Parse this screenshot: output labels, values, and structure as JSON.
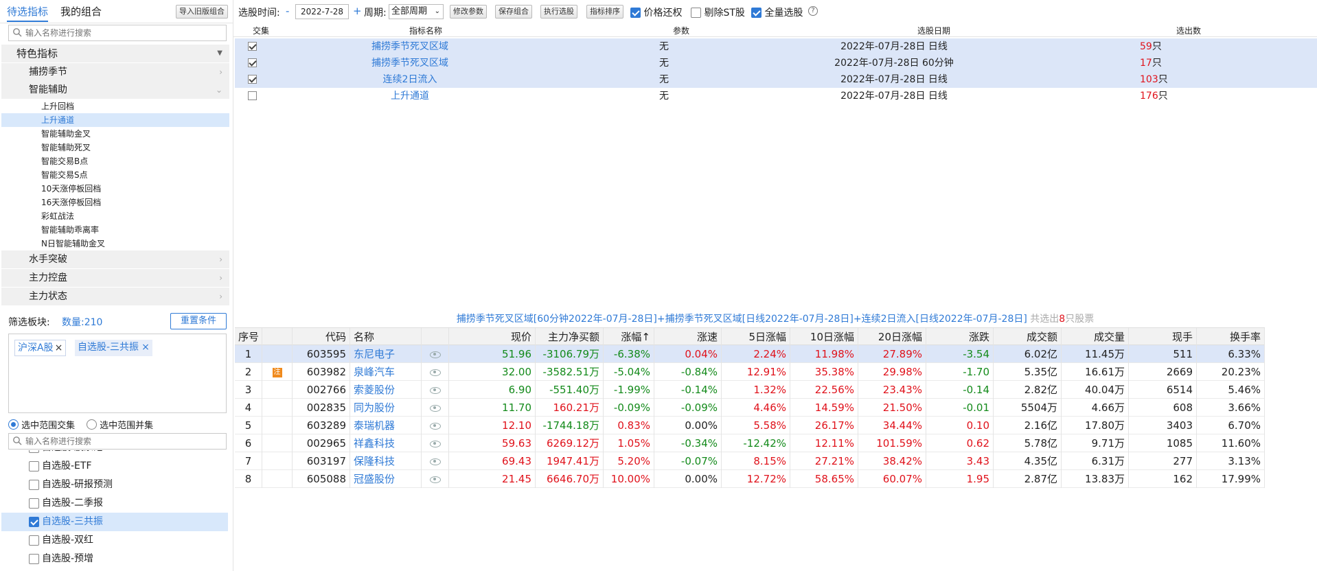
{
  "tabs": {
    "candidate": "待选指标",
    "my_combo": "我的组合",
    "import_old": "导入旧版组合"
  },
  "search": {
    "placeholder": "输入名称进行搜索"
  },
  "tree": {
    "root": "特色指标",
    "categories": [
      {
        "label": "捕捞季节"
      },
      {
        "label": "智能辅助"
      }
    ],
    "sub_items": [
      "上升回档",
      "上升通道",
      "智能辅助金叉",
      "智能辅助死叉",
      "智能交易B点",
      "智能交易S点",
      "10天涨停板回档",
      "16天涨停板回档",
      "彩虹战法",
      "智能辅助乖离率",
      "N日智能辅助金叉"
    ],
    "categories_after": [
      {
        "label": "水手突破"
      },
      {
        "label": "主力控盘"
      },
      {
        "label": "主力状态"
      }
    ]
  },
  "filter": {
    "label": "筛选板块:",
    "count_label": "数量:210",
    "reset": "重置条件",
    "tags": [
      "沪深A股",
      "自选股-三共振"
    ],
    "radio_intersect": "选中范围交集",
    "radio_union": "选中范围并集"
  },
  "stock_lists": [
    "自选股-股票池",
    "自选股-ETF",
    "自选股-研报预测",
    "自选股-二季报",
    "自选股-三共振",
    "自选股-双红",
    "自选股-预增"
  ],
  "toolbar": {
    "time_label": "选股时间:",
    "minus": "-",
    "date": "2022-7-28",
    "plus": "+",
    "period_label": "周期:",
    "period_value": "全部周期",
    "modify": "修改参数",
    "save": "保存组合",
    "execute": "执行选股",
    "sort": "指标排序",
    "price_restore": "价格还权",
    "remove_st": "剔除ST股",
    "full_select": "全量选股",
    "help": "?"
  },
  "indicator_table": {
    "headers": [
      "交集",
      "指标名称",
      "参数",
      "选股日期",
      "选出数"
    ],
    "rows": [
      {
        "checked": true,
        "name": "捕捞季节死叉区域",
        "param": "无",
        "date": "2022年-07月-28日 日线",
        "count": "59",
        "unit": "只"
      },
      {
        "checked": true,
        "name": "捕捞季节死叉区域",
        "param": "无",
        "date": "2022年-07月-28日 60分钟",
        "count": "17",
        "unit": "只"
      },
      {
        "checked": true,
        "name": "连续2日流入",
        "param": "无",
        "date": "2022年-07月-28日 日线",
        "count": "103",
        "unit": "只"
      },
      {
        "checked": false,
        "name": "上升通道",
        "param": "无",
        "date": "2022年-07月-28日 日线",
        "count": "176",
        "unit": "只"
      }
    ]
  },
  "summary": {
    "text": "捕捞季节死叉区域[60分钟2022年-07月-28日]+捕捞季节死叉区域[日线2022年-07月-28日]+连续2日流入[日线2022年-07月-28日]",
    "prefix": "共选出",
    "count": "8",
    "suffix": "只股票"
  },
  "stock_table": {
    "headers": [
      "序号",
      "",
      "代码",
      "名称",
      "",
      "现价",
      "主力净买额",
      "涨幅↑",
      "涨速",
      "5日涨幅",
      "10日涨幅",
      "20日涨幅",
      "涨跌",
      "成交额",
      "成交量",
      "现手",
      "换手率"
    ],
    "rows": [
      {
        "no": "1",
        "flag": "",
        "code": "603595",
        "name": "东尼电子",
        "price": "51.96",
        "net": "-3106.79万",
        "chg": "-6.38%",
        "speed": "0.04%",
        "d5": "2.24%",
        "d10": "11.98%",
        "d20": "27.89%",
        "diff": "-3.54",
        "amount": "6.02亿",
        "vol": "11.45万",
        "hand": "511",
        "turnover": "6.33%"
      },
      {
        "no": "2",
        "flag": "注",
        "code": "603982",
        "name": "泉峰汽车",
        "price": "32.00",
        "net": "-3582.51万",
        "chg": "-5.04%",
        "speed": "-0.84%",
        "d5": "12.91%",
        "d10": "35.38%",
        "d20": "29.98%",
        "diff": "-1.70",
        "amount": "5.35亿",
        "vol": "16.61万",
        "hand": "2669",
        "turnover": "20.23%"
      },
      {
        "no": "3",
        "flag": "",
        "code": "002766",
        "name": "索菱股份",
        "price": "6.90",
        "net": "-551.40万",
        "chg": "-1.99%",
        "speed": "-0.14%",
        "d5": "1.32%",
        "d10": "22.56%",
        "d20": "23.43%",
        "diff": "-0.14",
        "amount": "2.82亿",
        "vol": "40.04万",
        "hand": "6514",
        "turnover": "5.46%"
      },
      {
        "no": "4",
        "flag": "",
        "code": "002835",
        "name": "同为股份",
        "price": "11.70",
        "net": "160.21万",
        "chg": "-0.09%",
        "speed": "-0.09%",
        "d5": "4.46%",
        "d10": "14.59%",
        "d20": "21.50%",
        "diff": "-0.01",
        "amount": "5504万",
        "vol": "4.66万",
        "hand": "608",
        "turnover": "3.66%"
      },
      {
        "no": "5",
        "flag": "",
        "code": "603289",
        "name": "泰瑞机器",
        "price": "12.10",
        "net": "-1744.18万",
        "chg": "0.83%",
        "speed": "0.00%",
        "d5": "5.58%",
        "d10": "26.17%",
        "d20": "34.44%",
        "diff": "0.10",
        "amount": "2.16亿",
        "vol": "17.80万",
        "hand": "3403",
        "turnover": "6.70%"
      },
      {
        "no": "6",
        "flag": "",
        "code": "002965",
        "name": "祥鑫科技",
        "price": "59.63",
        "net": "6269.12万",
        "chg": "1.05%",
        "speed": "-0.34%",
        "d5": "-12.42%",
        "d10": "12.11%",
        "d20": "101.59%",
        "diff": "0.62",
        "amount": "5.78亿",
        "vol": "9.71万",
        "hand": "1085",
        "turnover": "11.60%"
      },
      {
        "no": "7",
        "flag": "",
        "code": "603197",
        "name": "保隆科技",
        "price": "69.43",
        "net": "1947.41万",
        "chg": "5.20%",
        "speed": "-0.07%",
        "d5": "8.15%",
        "d10": "27.21%",
        "d20": "38.42%",
        "diff": "3.43",
        "amount": "4.35亿",
        "vol": "6.31万",
        "hand": "277",
        "turnover": "3.13%"
      },
      {
        "no": "8",
        "flag": "",
        "code": "605088",
        "name": "冠盛股份",
        "price": "21.45",
        "net": "6646.70万",
        "chg": "10.00%",
        "speed": "0.00%",
        "d5": "12.72%",
        "d10": "58.65%",
        "d20": "60.07%",
        "diff": "1.95",
        "amount": "2.87亿",
        "vol": "13.83万",
        "hand": "162",
        "turnover": "17.99%"
      }
    ]
  },
  "colors": {
    "accent": "#2f7ad6",
    "up": "#e0121b",
    "down": "#138a1a",
    "selected_row": "#dce6f8"
  }
}
